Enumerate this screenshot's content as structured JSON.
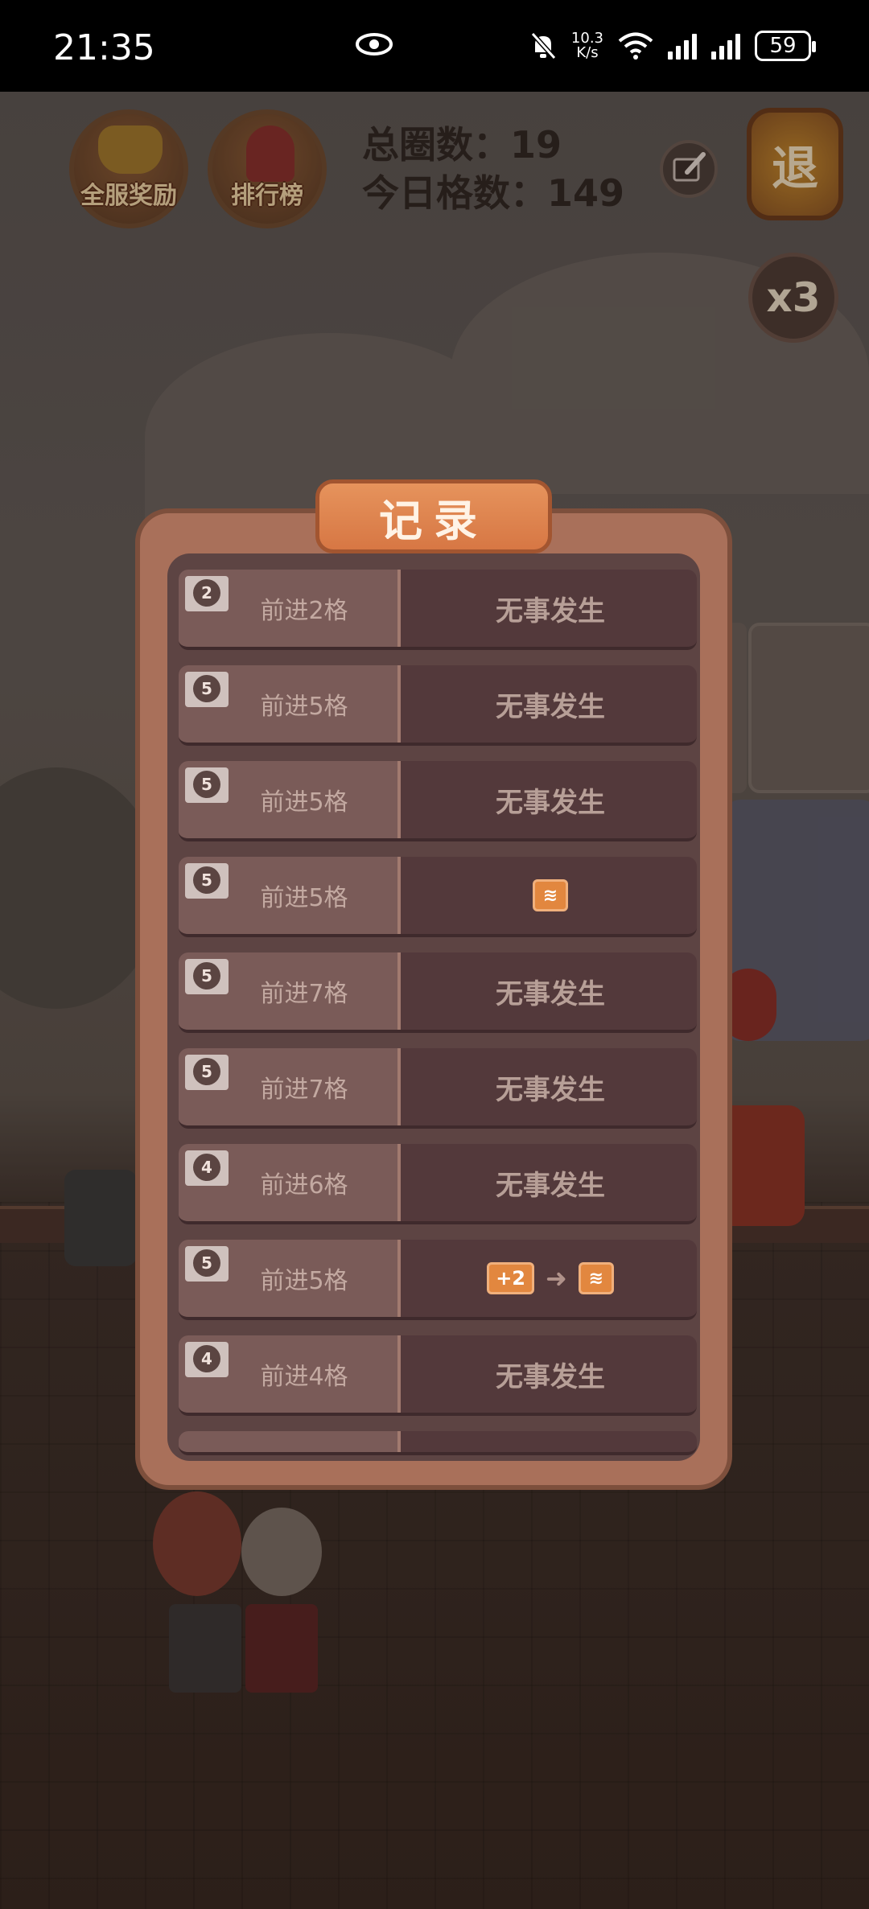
{
  "status_bar": {
    "time": "21:35",
    "net_speed_value": "10.3",
    "net_speed_unit": "K/s",
    "battery": "59"
  },
  "top_bar": {
    "server_reward_label": "全服奖励",
    "ranking_label": "排行榜",
    "total_laps": "总圈数：19",
    "today_steps": "今日格数：149",
    "exit_label": "退",
    "multiplier": "x3"
  },
  "record_dialog": {
    "title": "记录",
    "rows": [
      {
        "dice": "2",
        "move": "前进2格",
        "event": "无事发生"
      },
      {
        "dice": "5",
        "move": "前进5格",
        "event": "无事发生"
      },
      {
        "dice": "5",
        "move": "前进5格",
        "event": "无事发生"
      },
      {
        "dice": "5",
        "move": "前进5格",
        "event": ""
      },
      {
        "dice": "5",
        "move": "前进7格",
        "event": "无事发生"
      },
      {
        "dice": "5",
        "move": "前进7格",
        "event": "无事发生"
      },
      {
        "dice": "4",
        "move": "前进6格",
        "event": "无事发生"
      },
      {
        "dice": "5",
        "move": "前进5格",
        "event": "",
        "bonus": "+2"
      },
      {
        "dice": "4",
        "move": "前进4格",
        "event": "无事发生"
      }
    ]
  }
}
